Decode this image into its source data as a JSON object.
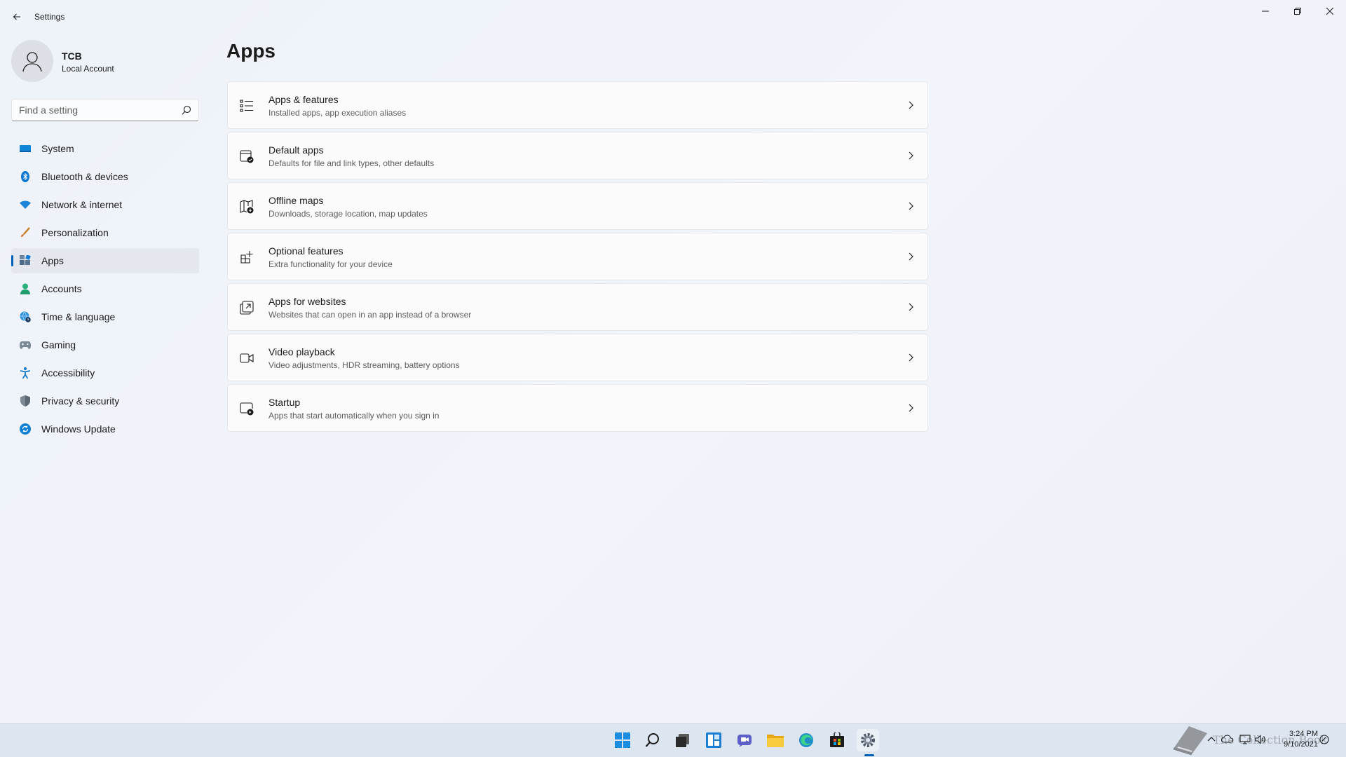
{
  "window": {
    "title": "Settings"
  },
  "profile": {
    "name": "TCB",
    "account_type": "Local Account"
  },
  "search": {
    "placeholder": "Find a setting"
  },
  "sidebar": {
    "items": [
      {
        "label": "System",
        "icon": "system-icon",
        "active": false
      },
      {
        "label": "Bluetooth & devices",
        "icon": "bluetooth-icon",
        "active": false
      },
      {
        "label": "Network & internet",
        "icon": "wifi-icon",
        "active": false
      },
      {
        "label": "Personalization",
        "icon": "brush-icon",
        "active": false
      },
      {
        "label": "Apps",
        "icon": "apps-icon",
        "active": true
      },
      {
        "label": "Accounts",
        "icon": "person-icon",
        "active": false
      },
      {
        "label": "Time & language",
        "icon": "globe-clock-icon",
        "active": false
      },
      {
        "label": "Gaming",
        "icon": "gamepad-icon",
        "active": false
      },
      {
        "label": "Accessibility",
        "icon": "accessibility-icon",
        "active": false
      },
      {
        "label": "Privacy & security",
        "icon": "shield-icon",
        "active": false
      },
      {
        "label": "Windows Update",
        "icon": "update-icon",
        "active": false
      }
    ]
  },
  "main": {
    "title": "Apps",
    "cards": [
      {
        "title": "Apps & features",
        "subtitle": "Installed apps, app execution aliases",
        "icon": "list-icon"
      },
      {
        "title": "Default apps",
        "subtitle": "Defaults for file and link types, other defaults",
        "icon": "default-apps-icon"
      },
      {
        "title": "Offline maps",
        "subtitle": "Downloads, storage location, map updates",
        "icon": "map-icon"
      },
      {
        "title": "Optional features",
        "subtitle": "Extra functionality for your device",
        "icon": "add-grid-icon"
      },
      {
        "title": "Apps for websites",
        "subtitle": "Websites that can open in an app instead of a browser",
        "icon": "open-external-icon"
      },
      {
        "title": "Video playback",
        "subtitle": "Video adjustments, HDR streaming, battery options",
        "icon": "video-icon"
      },
      {
        "title": "Startup",
        "subtitle": "Apps that start automatically when you sign in",
        "icon": "startup-icon"
      }
    ]
  },
  "taskbar": {
    "apps": [
      "start-icon",
      "search-icon",
      "task-view-icon",
      "widgets-icon",
      "chat-icon",
      "file-explorer-icon",
      "edge-icon",
      "store-icon",
      "settings-icon"
    ],
    "clock": {
      "time": "3:24 PM",
      "date": "9/10/2021"
    }
  },
  "watermark": {
    "text": "The Collection Book"
  },
  "colors": {
    "accent": "#005fb8",
    "background": "#eef1f8",
    "card": "#fbfbfc"
  }
}
